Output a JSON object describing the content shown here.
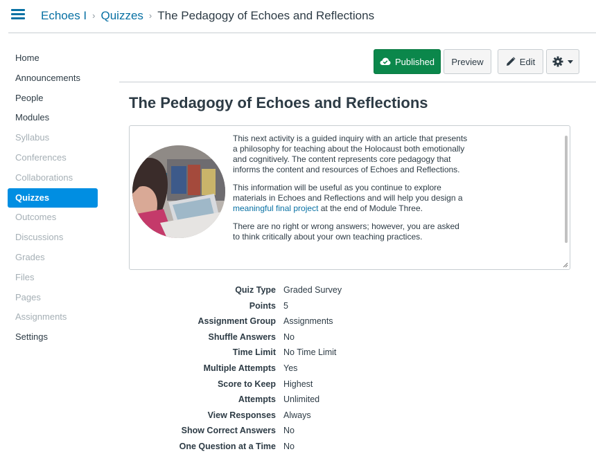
{
  "breadcrumb": {
    "course": "Echoes I",
    "section": "Quizzes",
    "current": "The Pedagogy of Echoes and Reflections"
  },
  "sidebar": {
    "items": [
      {
        "label": "Home",
        "state": "enabled"
      },
      {
        "label": "Announcements",
        "state": "enabled"
      },
      {
        "label": "People",
        "state": "enabled"
      },
      {
        "label": "Modules",
        "state": "enabled"
      },
      {
        "label": "Syllabus",
        "state": "disabled"
      },
      {
        "label": "Conferences",
        "state": "disabled"
      },
      {
        "label": "Collaborations",
        "state": "disabled"
      },
      {
        "label": "Quizzes",
        "state": "active"
      },
      {
        "label": "Outcomes",
        "state": "disabled"
      },
      {
        "label": "Discussions",
        "state": "disabled"
      },
      {
        "label": "Grades",
        "state": "disabled"
      },
      {
        "label": "Files",
        "state": "disabled"
      },
      {
        "label": "Pages",
        "state": "disabled"
      },
      {
        "label": "Assignments",
        "state": "disabled"
      },
      {
        "label": "Settings",
        "state": "enabled"
      }
    ]
  },
  "toolbar": {
    "published_label": "Published",
    "preview_label": "Preview",
    "edit_label": "Edit"
  },
  "quiz": {
    "title": "The Pedagogy of Echoes and Reflections",
    "description": {
      "p1": "This next activity is a guided inquiry with an article that presents a philosophy for teaching about the Holocaust both emotionally and cognitively. The content represents core pedagogy that informs the content and resources of Echoes and Reflections.",
      "p2_before": "This information will be useful as you continue to explore materials in Echoes and Reflections and will help you design a ",
      "p2_link": "meaningful final project",
      "p2_after": " at the end of Module Three.",
      "p3": "There are no right or wrong answers; however, you are asked to think critically about your own teaching practices."
    },
    "details": [
      {
        "label": "Quiz Type",
        "value": "Graded Survey"
      },
      {
        "label": "Points",
        "value": "5"
      },
      {
        "label": "Assignment Group",
        "value": "Assignments"
      },
      {
        "label": "Shuffle Answers",
        "value": "No"
      },
      {
        "label": "Time Limit",
        "value": "No Time Limit"
      },
      {
        "label": "Multiple Attempts",
        "value": "Yes"
      },
      {
        "label": "Score to Keep",
        "value": "Highest"
      },
      {
        "label": "Attempts",
        "value": "Unlimited"
      },
      {
        "label": "View Responses",
        "value": "Always"
      },
      {
        "label": "Show Correct Answers",
        "value": "No"
      },
      {
        "label": "One Question at a Time",
        "value": "No"
      }
    ]
  },
  "colors": {
    "link": "#0770a3",
    "active_nav": "#008ee2",
    "published": "#0b874b",
    "disabled_text": "#a5afb5"
  },
  "icons": [
    "hamburger-icon",
    "cloud-check-icon",
    "pencil-icon",
    "gear-icon",
    "caret-down-icon"
  ]
}
